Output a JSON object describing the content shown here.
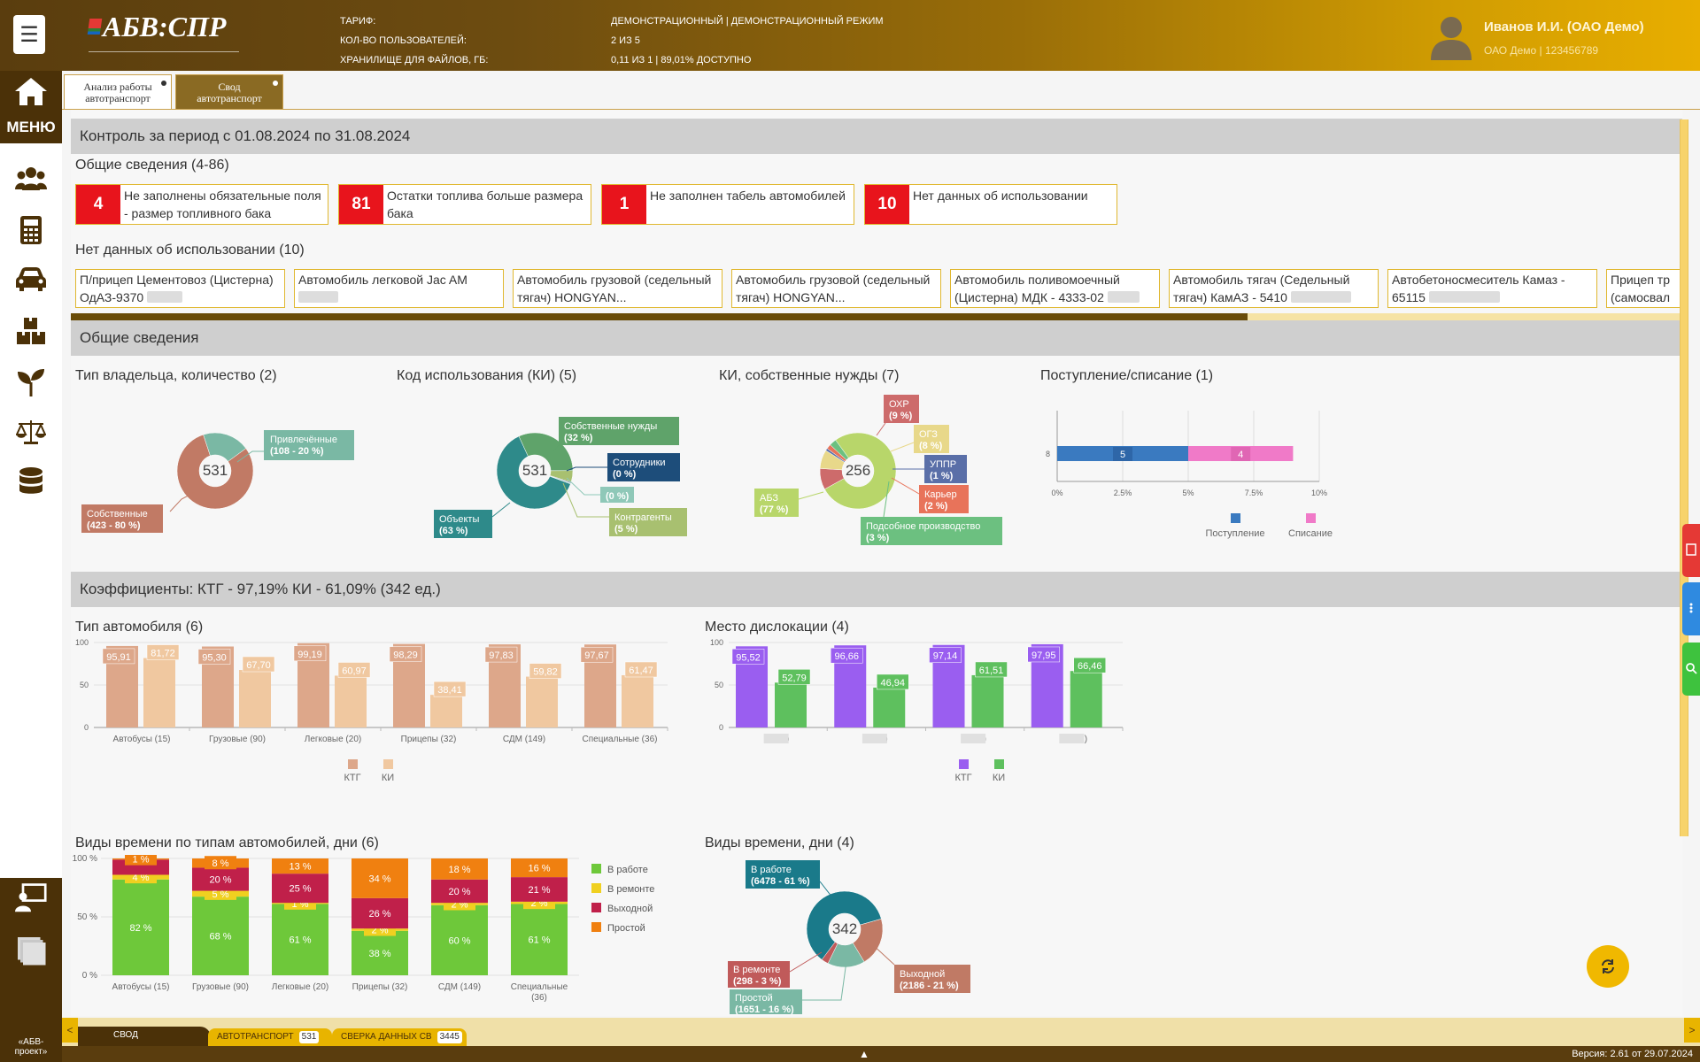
{
  "header": {
    "logo": "АБВ:СПР",
    "info_labels": [
      "ТАРИФ:",
      "КОЛ-ВО ПОЛЬЗОВАТЕЛЕЙ:",
      "ХРАНИЛИЩЕ ДЛЯ ФАЙЛОВ, ГБ:"
    ],
    "info_values": [
      "ДЕМОНСТРАЦИОННЫЙ  | ДЕМОНСТРАЦИОННЫЙ РЕЖИМ",
      "2 ИЗ 5",
      "0,11 ИЗ 1 | 89,01% ДОСТУПНО"
    ],
    "user_name": "Иванов И.И. (ОАО Демо)",
    "user_org": "ОАО Демо | 123456789"
  },
  "sidebar": {
    "menu_label": "МЕНЮ",
    "icons": [
      "home-icon",
      "users-icon",
      "calculator-icon",
      "car-icon",
      "boxes-icon",
      "plant-icon",
      "scales-icon",
      "database-icon",
      "remote-desktop-icon",
      "layers-icon"
    ],
    "bottom_label_1": "«АБВ-",
    "bottom_label_2": "проект»"
  },
  "tabs": [
    {
      "line1": "Анализ работы",
      "line2": "автотранспорт"
    },
    {
      "line1": "Свод",
      "line2": "автотранспорт"
    }
  ],
  "control": {
    "period_title": "Контроль за период с 01.08.2024 по 31.08.2024",
    "general_title": "Общие сведения (4-86)",
    "cards": [
      {
        "num": "4",
        "text": "Не заполнены обязательные поля - размер топливного бака"
      },
      {
        "num": "81",
        "text": "Остатки топлива больше размера бака"
      },
      {
        "num": "1",
        "text": "Не заполнен табель автомобилей"
      },
      {
        "num": "10",
        "text": "Нет данных об использовании"
      }
    ],
    "no_data_title": "Нет данных об использовании (10)",
    "vehicles": [
      "П/прицеп Цементовоз (Цистерна) ОдАЗ-9370",
      "Автомобиль легковой Jac AM",
      "Автомобиль грузовой (седельный тягач) HONGYAN...",
      "Автомобиль грузовой (седельный тягач) HONGYAN...",
      "Автомобиль поливомоечный (Цистерна) МДК - 4333-02",
      "Автомобиль тягач (Седельный тягач) КамАЗ - 5410",
      "Автобетоносмеситель Камаз - 65115",
      "Прицеп тр (самосвал"
    ],
    "progress_pct": 73
  },
  "general": {
    "section_title": "Общие сведения",
    "owner": {
      "title": "Тип владельца, количество (2)",
      "center": "531",
      "slices": [
        {
          "label": "Собственные",
          "detail": "(423 - 80 %)",
          "value": 80,
          "color": "#c17a65"
        },
        {
          "label": "Привлечённые",
          "detail": "(108 - 20 %)",
          "value": 20,
          "color": "#7ab8a4"
        }
      ]
    },
    "ki_code": {
      "title": "Код использования (КИ) (5)",
      "center": "531",
      "slices": [
        {
          "label": "Объекты",
          "detail": "(63 %)",
          "value": 63,
          "color": "#2e8a8a"
        },
        {
          "label": "Собственные нужды",
          "detail": "(32 %)",
          "value": 32,
          "color": "#5fa36a"
        },
        {
          "label": "Контрагенты",
          "detail": "(5 %)",
          "value": 5,
          "color": "#a8c070"
        },
        {
          "label": "Сотрудники",
          "detail": "(0 %)",
          "value": 0.4,
          "color": "#1d4d7a"
        },
        {
          "label": "",
          "detail": "(0 %)",
          "value": 0.3,
          "color": "#8fc8b8"
        }
      ]
    },
    "ki_own": {
      "title": "КИ, собственные нужды (7)",
      "center": "256",
      "slices": [
        {
          "label": "АБЗ",
          "detail": "(77 %)",
          "value": 77,
          "color": "#b8d66a"
        },
        {
          "label": "ОХР",
          "detail": "(9 %)",
          "value": 9,
          "color": "#cd6b6b"
        },
        {
          "label": "ОГЗ",
          "detail": "(8 %)",
          "value": 8,
          "color": "#e8d88a"
        },
        {
          "label": "УППР",
          "detail": "(1 %)",
          "value": 1,
          "color": "#5a6fa8"
        },
        {
          "label": "Карьер",
          "detail": "(2 %)",
          "value": 2,
          "color": "#e8735a"
        },
        {
          "label": "Подсобное производство",
          "detail": "(3 %)",
          "value": 3,
          "color": "#6cc080"
        }
      ]
    },
    "income": {
      "title": "Поступление/списание (1)",
      "category": "8",
      "ticks": [
        "0%",
        "2.5%",
        "5%",
        "7.5%",
        "10%"
      ],
      "series": [
        {
          "name": "Поступление",
          "value": 5,
          "color": "#3a7ac0"
        },
        {
          "name": "Списание",
          "value": 4,
          "color": "#f07ac8"
        }
      ]
    }
  },
  "coef": {
    "section_title": "Коэффициенты: КТГ - 97,19% КИ - 61,09% (342 ед.)",
    "type_title": "Тип автомобиля (6)",
    "location_title": "Место дислокации (4)",
    "time_type_title": "Виды времени по типам автомобилей, дни (6)",
    "time_title": "Виды времени, дни (4)"
  },
  "chart_data": [
    {
      "type": "bar",
      "title": "Тип автомобиля (6)",
      "categories": [
        "Автобусы (15)",
        "Грузовые (90)",
        "Легковые (20)",
        "Прицепы (32)",
        "СДМ (149)",
        "Специальные (36)"
      ],
      "series": [
        {
          "name": "КТГ",
          "values": [
            95.91,
            95.3,
            99.19,
            98.29,
            97.83,
            97.67
          ],
          "labels": [
            "95,91",
            "95,30",
            "99,19",
            "98,29",
            "97,83",
            "97,67"
          ],
          "color": "#dda78a"
        },
        {
          "name": "КИ",
          "values": [
            81.72,
            67.7,
            60.97,
            38.41,
            59.82,
            61.47
          ],
          "labels": [
            "81,72",
            "67,70",
            "60,97",
            "38,41",
            "59,82",
            "61,47"
          ],
          "color": "#f0c8a0"
        }
      ],
      "yticks": [
        "0",
        "50",
        "100"
      ],
      "ylim": [
        0,
        100
      ]
    },
    {
      "type": "bar",
      "title": "Место дислокации (4)",
      "categories": [
        "г. (77)",
        "г. (29)",
        "г. (44)",
        "г. (192)"
      ],
      "series": [
        {
          "name": "КТГ",
          "values": [
            95.52,
            96.66,
            97.14,
            97.95
          ],
          "labels": [
            "95,52",
            "96,66",
            "97,14",
            "97,95"
          ],
          "color": "#9a5ef0"
        },
        {
          "name": "КИ",
          "values": [
            52.79,
            46.94,
            61.51,
            66.46
          ],
          "labels": [
            "52,79",
            "46,94",
            "61,51",
            "66,46"
          ],
          "color": "#5ec05e"
        }
      ],
      "yticks": [
        "0",
        "50",
        "100"
      ],
      "ylim": [
        0,
        100
      ]
    },
    {
      "type": "bar",
      "stacked": true,
      "title": "Виды времени по типам автомобилей, дни (6)",
      "categories": [
        "Автобусы (15)",
        "Грузовые (90)",
        "Легковые (20)",
        "Прицепы (32)",
        "СДМ (149)",
        "Специальные (36)"
      ],
      "yticks": [
        "0 %",
        "50 %",
        "100 %"
      ],
      "series": [
        {
          "name": "В работе",
          "color": "#6ec83a",
          "values": [
            82,
            68,
            61,
            38,
            60,
            61
          ],
          "labels": [
            "82 %",
            "68 %",
            "61 %",
            "38 %",
            "60 %",
            "61 %"
          ]
        },
        {
          "name": "В ремонте",
          "color": "#f0d020",
          "values": [
            4,
            5,
            1,
            2,
            2,
            2
          ],
          "labels": [
            "4 %",
            "5 %",
            "1 %",
            "2 %",
            "2 %",
            "2 %"
          ]
        },
        {
          "name": "Выходной",
          "color": "#c0204a",
          "values": [
            13,
            20,
            25,
            26,
            20,
            21
          ],
          "labels": [
            "",
            "20 %",
            "25 %",
            "26 %",
            "20 %",
            "21 %"
          ]
        },
        {
          "name": "Простой",
          "color": "#f08010",
          "values": [
            1,
            8,
            13,
            34,
            18,
            16
          ],
          "labels": [
            "1 %",
            "8 %",
            "13 %",
            "34 %",
            "18 %",
            "16 %"
          ]
        }
      ]
    },
    {
      "type": "pie",
      "title": "Виды времени, дни (4)",
      "center": "342",
      "slices": [
        {
          "label": "В работе",
          "detail": "(6478 - 61 %)",
          "value": 61,
          "color": "#1a7a8a"
        },
        {
          "label": "Выходной",
          "detail": "(2186 - 21 %)",
          "value": 21,
          "color": "#c07a65"
        },
        {
          "label": "Простой",
          "detail": "(1651 - 16 %)",
          "value": 16,
          "color": "#7ab8a4"
        },
        {
          "label": "В ремонте",
          "detail": "(298 - 3 %)",
          "value": 3,
          "color": "#c05a5a"
        }
      ]
    }
  ],
  "bottom": {
    "tab_svod": "СВОД",
    "tab_auto": "АВТОТРАНСПОРТ",
    "tab_auto_count": "531",
    "tab_sverka": "СВЕРКА ДАННЫХ СВ",
    "tab_sverka_count": "3445",
    "version": "Версия: 2.61 от 29.07.2024"
  },
  "colors": {
    "accent": "#e8b400",
    "brand_dark": "#4b3108",
    "alert": "#e8141c"
  }
}
